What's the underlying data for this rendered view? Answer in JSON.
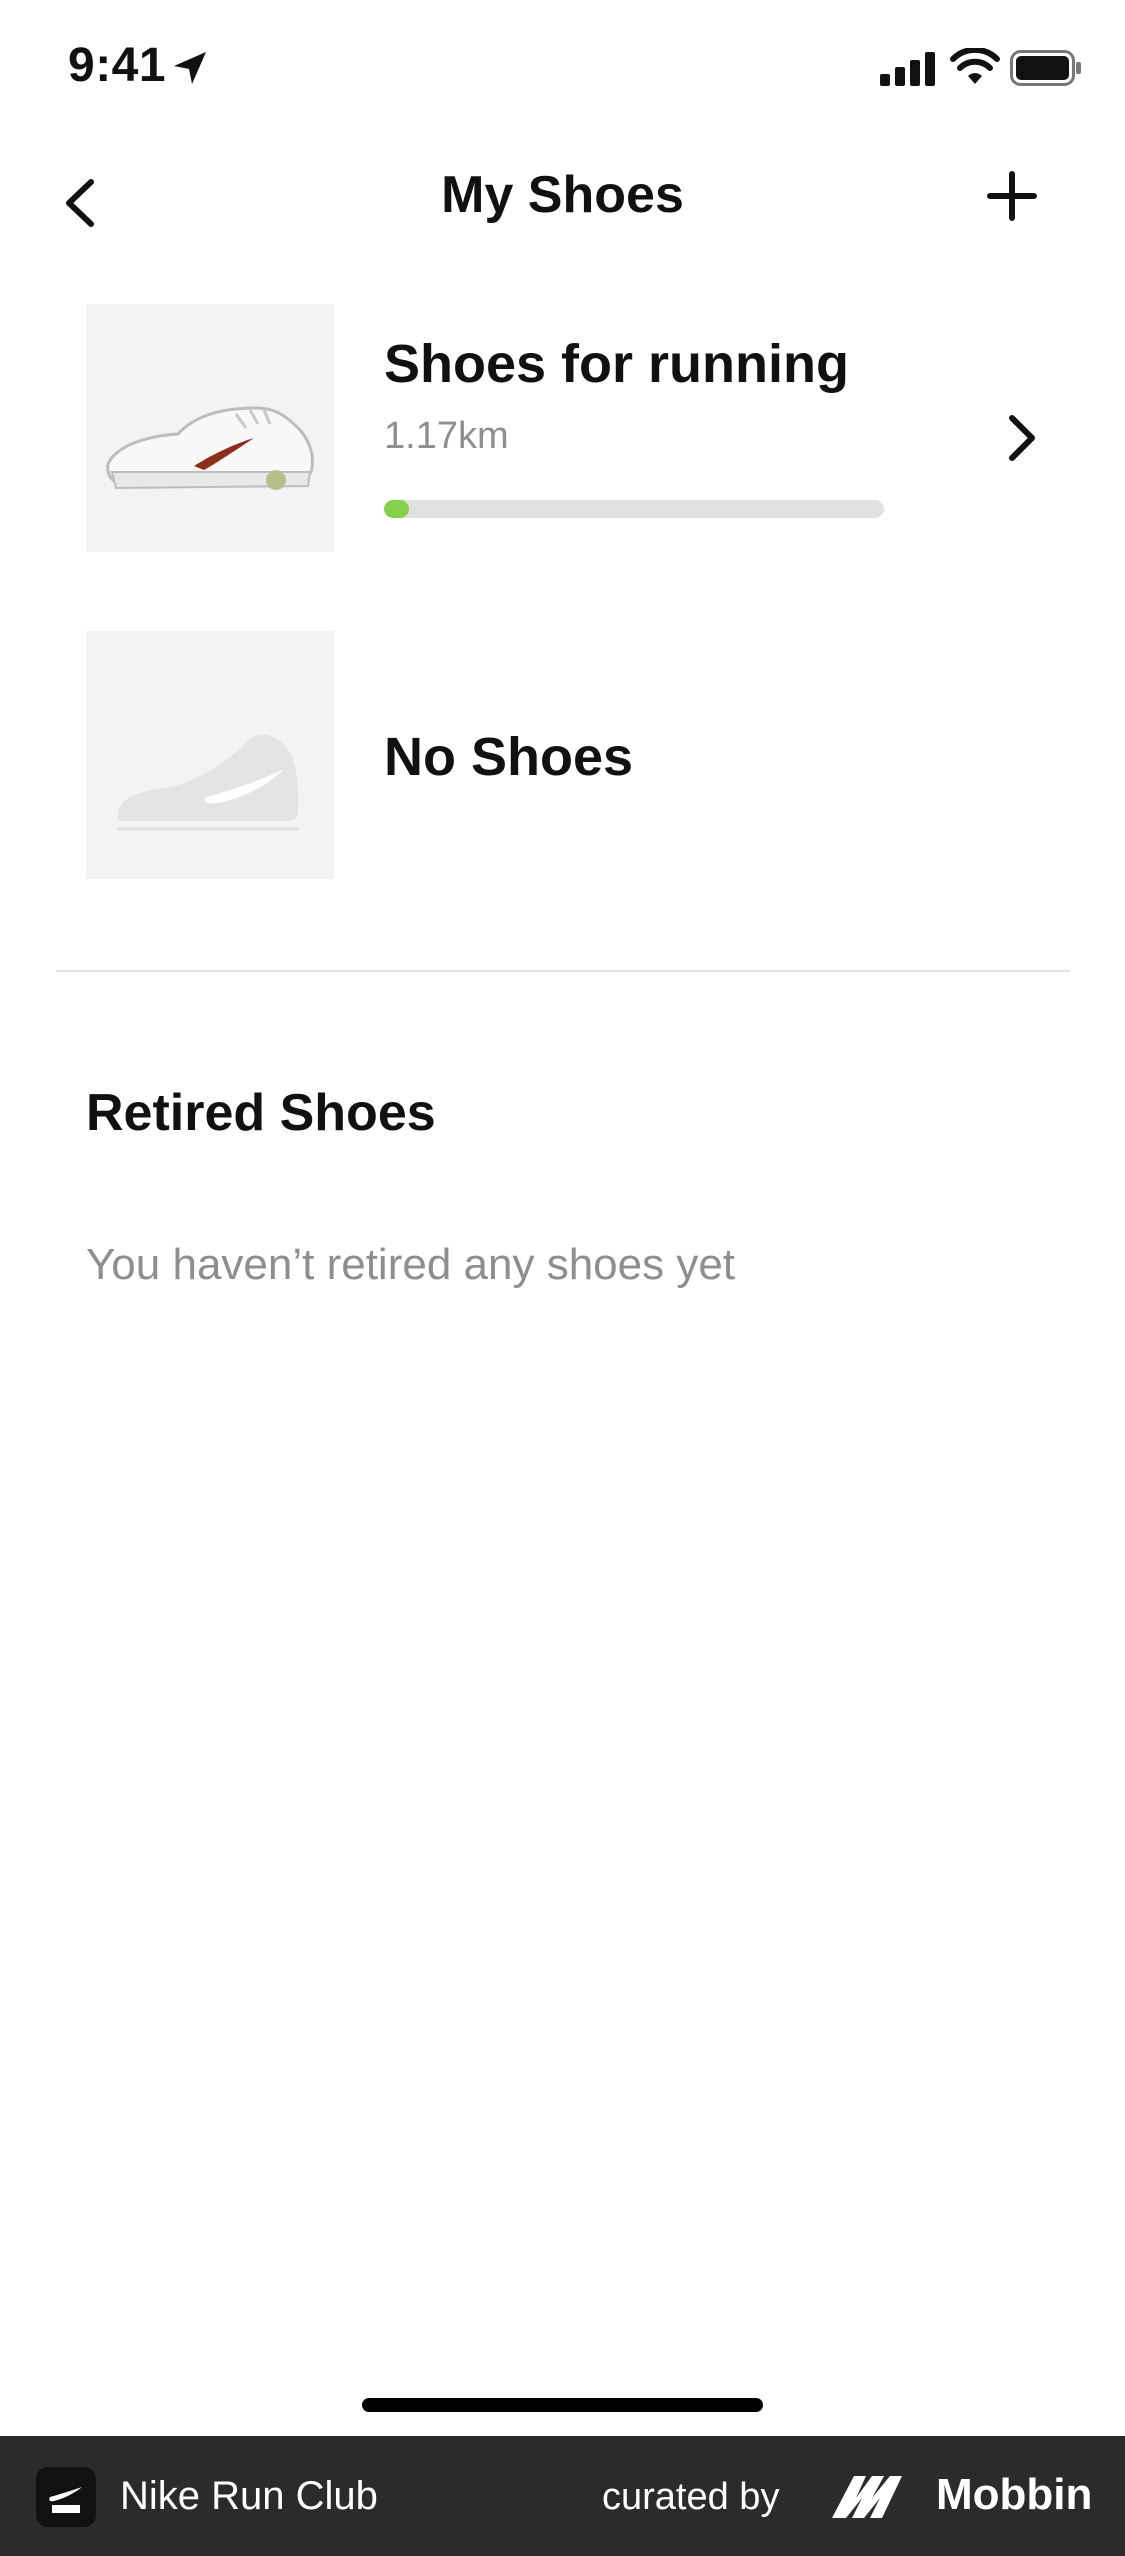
{
  "status_bar": {
    "time": "9:41",
    "icons": [
      "location-arrow-icon",
      "cellular-signal-icon",
      "wifi-icon",
      "battery-icon"
    ]
  },
  "nav": {
    "title": "My Shoes",
    "back_icon": "chevron-left-icon",
    "add_icon": "plus-icon"
  },
  "shoes": [
    {
      "name": "Shoes for running",
      "distance": "1.17km",
      "progress": 0.05,
      "image": "white-sneaker-thumbnail",
      "chevron_icon": "chevron-right-icon"
    },
    {
      "name": "No Shoes",
      "image": "placeholder-shoe-thumbnail"
    }
  ],
  "retired": {
    "title": "Retired Shoes",
    "empty_message": "You haven’t retired any shoes yet"
  },
  "footer": {
    "app_name": "Nike Run Club",
    "curated_by": "curated by",
    "brand": "Mobbin"
  },
  "colors": {
    "accent_progress": "#84d14a",
    "track": "#e1e1e1",
    "muted_text": "#8e8e8e",
    "footer_bg": "#2b2b2b"
  }
}
